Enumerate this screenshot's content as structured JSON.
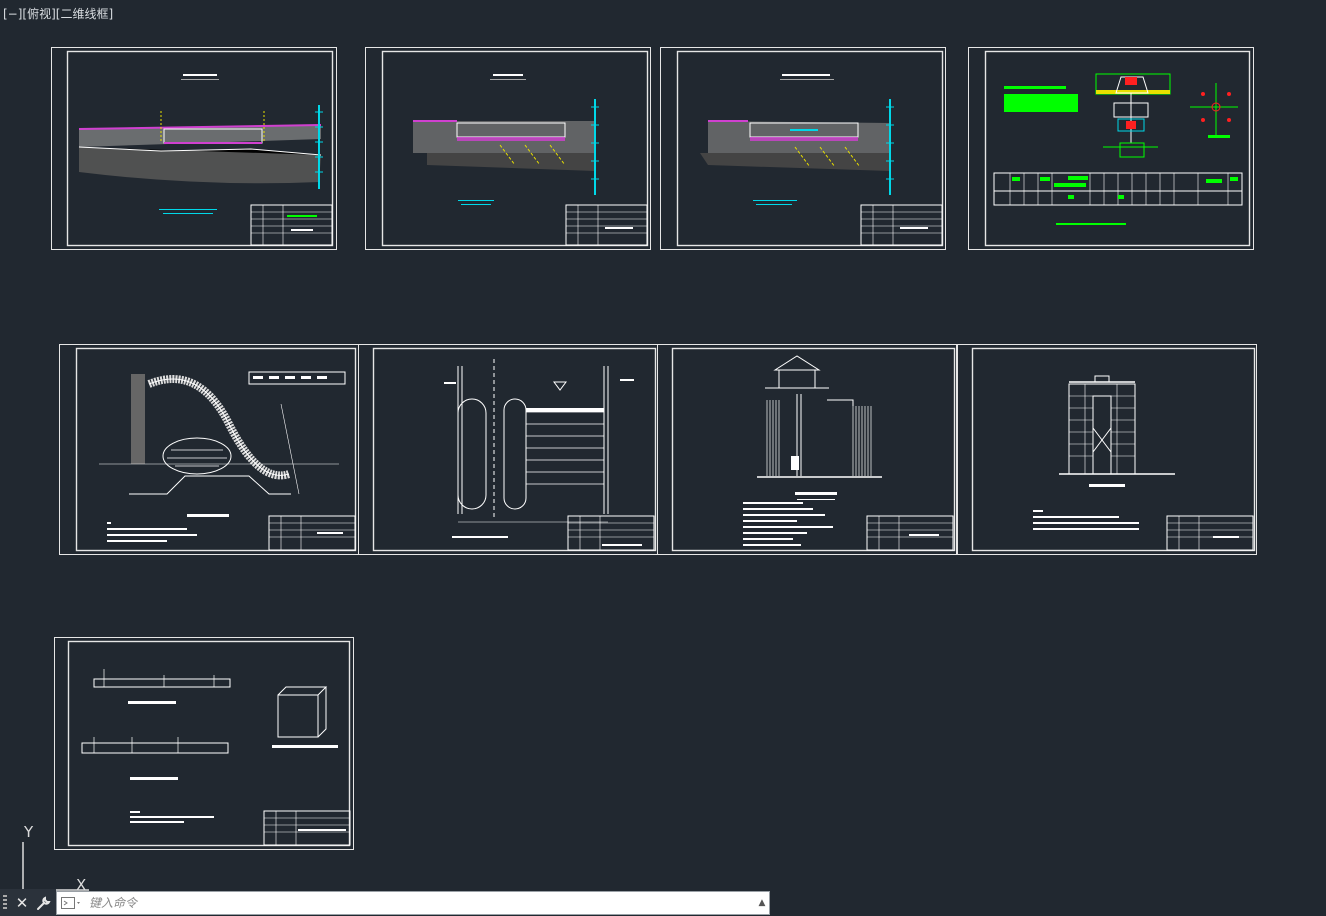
{
  "viewport": {
    "label": "[−][俯视][二维线框]"
  },
  "command_line": {
    "placeholder": "键入命令",
    "close_glyph": "✕",
    "settings_glyph": "🔧",
    "history_glyph": "▲"
  },
  "ucs": {
    "y_label": "Y",
    "x_label": "X"
  },
  "colors": {
    "background": "#212830",
    "sheet_border": "#e6e6e6",
    "linework": "#ffffff",
    "cyan": "#00d8e8",
    "magenta": "#d040d0",
    "green": "#00ff00",
    "yellow": "#e8e000",
    "red": "#ff2020"
  },
  "layouts": [
    {
      "name": "section-sheet-1"
    },
    {
      "name": "section-sheet-2"
    },
    {
      "name": "section-sheet-3"
    },
    {
      "name": "pipe-detail-sheet"
    },
    {
      "name": "spillway-sheet"
    },
    {
      "name": "plan-sheet"
    },
    {
      "name": "gatehouse-sheet"
    },
    {
      "name": "tower-sheet"
    },
    {
      "name": "detail-sheet"
    }
  ]
}
